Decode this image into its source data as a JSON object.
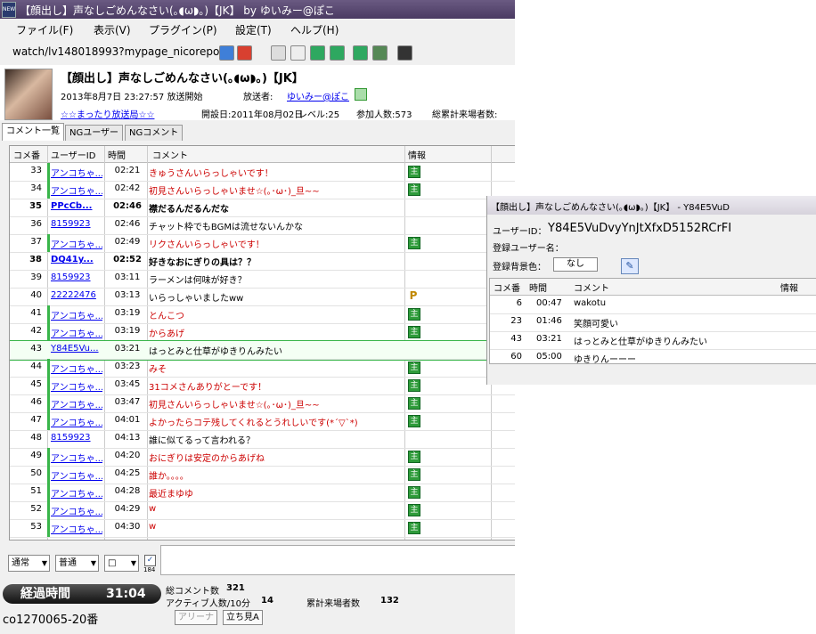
{
  "window": {
    "title": "【顔出し】声なしごめんなさい(｡◖ω◗｡)【JK】 by ゆいみー@ぽこ",
    "icon_text": "NEW"
  },
  "menu": [
    "ファイル(F)",
    "表示(V)",
    "プラグイン(P)",
    "設定(T)",
    "ヘルプ(H)"
  ],
  "address": "watch/lv148018993?mypage_nicorepo",
  "program": {
    "title": "【顔出し】声なしごめんなさい(｡◖ω◗｡)【JK】",
    "start": "2013年8月7日 23:27:57 放送開始",
    "broadcaster_label": "放送者:",
    "broadcaster": "ゆいみー@ぽこ",
    "community": "☆☆まったり放送局☆☆",
    "opened": "開設日:2011年08月02日",
    "level": "レベル:25",
    "participants": "参加人数:573",
    "total_visitors": "総累計来場者数:"
  },
  "tabs": [
    "コメント一覧",
    "NGユーザー",
    "NGコメント"
  ],
  "grid": {
    "headers": [
      "コメ番",
      "ユーザーID",
      "時間",
      "コメント",
      "情報"
    ],
    "rows": [
      {
        "no": "33",
        "uid": "アンコちゃ...",
        "time": "02:21",
        "comment": "きゅうさんいらっしゃいです！",
        "color": "#cc0000",
        "bold": false,
        "icon": "g",
        "green": true
      },
      {
        "no": "34",
        "uid": "アンコちゃ...",
        "time": "02:42",
        "comment": "初見さんいらっしゃいませ☆(｡･ω･)_旦~~",
        "color": "#cc0000",
        "bold": false,
        "icon": "g",
        "green": true
      },
      {
        "no": "35",
        "uid": "PPcCb...",
        "time": "02:46",
        "comment": "襟だるんだるんだな",
        "color": "#000000",
        "bold": true,
        "icon": "",
        "green": false
      },
      {
        "no": "36",
        "uid": "8159923",
        "time": "02:46",
        "comment": "チャット枠でもBGMは流せないんかな",
        "color": "#000000",
        "bold": false,
        "icon": "",
        "green": false
      },
      {
        "no": "37",
        "uid": "アンコちゃ...",
        "time": "02:49",
        "comment": "リクさんいらっしゃいです！",
        "color": "#cc0000",
        "bold": false,
        "icon": "g",
        "green": true
      },
      {
        "no": "38",
        "uid": "DQ41y...",
        "time": "02:52",
        "comment": "好きなおにぎりの具は？？",
        "color": "#000000",
        "bold": true,
        "icon": "",
        "green": false
      },
      {
        "no": "39",
        "uid": "8159923",
        "time": "03:11",
        "comment": "ラーメンは何味が好き？",
        "color": "#000000",
        "bold": false,
        "icon": "",
        "green": false
      },
      {
        "no": "40",
        "uid": "22222476",
        "time": "03:13",
        "comment": "いらっしゃいましたww",
        "color": "#000000",
        "bold": false,
        "icon": "p",
        "green": false
      },
      {
        "no": "41",
        "uid": "アンコちゃ...",
        "time": "03:19",
        "comment": "とんこつ",
        "color": "#cc0000",
        "bold": false,
        "icon": "g",
        "green": true
      },
      {
        "no": "42",
        "uid": "アンコちゃ...",
        "time": "03:19",
        "comment": "からあげ",
        "color": "#cc0000",
        "bold": false,
        "icon": "g",
        "green": true
      },
      {
        "no": "43",
        "uid": "Y84E5Vu...",
        "time": "03:21",
        "comment": "はっとみと仕草がゆきりんみたい",
        "color": "#000000",
        "bold": false,
        "icon": "",
        "green": false,
        "selected": true
      },
      {
        "no": "44",
        "uid": "アンコちゃ...",
        "time": "03:23",
        "comment": "みそ",
        "color": "#cc0000",
        "bold": false,
        "icon": "g",
        "green": true
      },
      {
        "no": "45",
        "uid": "アンコちゃ...",
        "time": "03:45",
        "comment": "31コメさんありがとーです！",
        "color": "#cc0000",
        "bold": false,
        "icon": "g",
        "green": true
      },
      {
        "no": "46",
        "uid": "アンコちゃ...",
        "time": "03:47",
        "comment": "初見さんいらっしゃいませ☆(｡･ω･)_旦~~",
        "color": "#cc0000",
        "bold": false,
        "icon": "g",
        "green": true
      },
      {
        "no": "47",
        "uid": "アンコちゃ...",
        "time": "04:01",
        "comment": "よかったらコテ残してくれるとうれしいです(*´▽`*)",
        "color": "#cc0000",
        "bold": false,
        "icon": "g",
        "green": true
      },
      {
        "no": "48",
        "uid": "8159923",
        "time": "04:13",
        "comment": "誰に似てるって言われる？",
        "color": "#000000",
        "bold": false,
        "icon": "",
        "green": false
      },
      {
        "no": "49",
        "uid": "アンコちゃ...",
        "time": "04:20",
        "comment": "おにぎりは安定のからあげね",
        "color": "#cc0000",
        "bold": false,
        "icon": "g",
        "green": true
      },
      {
        "no": "50",
        "uid": "アンコちゃ...",
        "time": "04:25",
        "comment": "誰か。。。。",
        "color": "#cc0000",
        "bold": false,
        "icon": "g",
        "green": true
      },
      {
        "no": "51",
        "uid": "アンコちゃ...",
        "time": "04:28",
        "comment": "最近まゆゆ",
        "color": "#cc0000",
        "bold": false,
        "icon": "g",
        "green": true
      },
      {
        "no": "52",
        "uid": "アンコちゃ...",
        "time": "04:29",
        "comment": "w",
        "color": "#cc0000",
        "bold": false,
        "icon": "g",
        "green": true
      },
      {
        "no": "53",
        "uid": "アンコちゃ...",
        "time": "04:30",
        "comment": "w",
        "color": "#cc0000",
        "bold": false,
        "icon": "g",
        "green": true
      }
    ]
  },
  "icon_glyphs": {
    "g": "主",
    "p": "P"
  },
  "controls": {
    "mode": "通常",
    "size": "普通",
    "color": "□",
    "check_label": "184"
  },
  "bottom": {
    "elapsed_label": "経過時間",
    "elapsed_value": "31:04",
    "total_comments_label": "総コメント数",
    "total_comments": "321",
    "active_label": "アクティブ人数/10分",
    "active": "14",
    "visitors_label": "累計来場者数",
    "visitors": "132",
    "community_slot": "co1270065-20番",
    "arena_button": "アリーナ",
    "standing_button": "立ち見A"
  },
  "popup": {
    "title": "【顔出し】声なしごめんなさい(｡◖ω◗｡)【JK】 - Y84E5VuD",
    "user_id_label": "ユーザーID：",
    "user_id": "Y84E5VuDvyYnJtXfxD5152RCrFI",
    "reg_name_label": "登録ユーザー名：",
    "bg_color_label": "登録背景色：",
    "bg_color_value": "なし",
    "headers": [
      "コメ番",
      "時間",
      "コメント",
      "情報"
    ],
    "rows": [
      {
        "no": "6",
        "time": "00:47",
        "comment": "wakotu"
      },
      {
        "no": "23",
        "time": "01:46",
        "comment": "笑顔可愛い"
      },
      {
        "no": "43",
        "time": "03:21",
        "comment": "はっとみと仕草がゆきりんみたい"
      },
      {
        "no": "60",
        "time": "05:00",
        "comment": "ゆきりんーーー"
      }
    ]
  }
}
